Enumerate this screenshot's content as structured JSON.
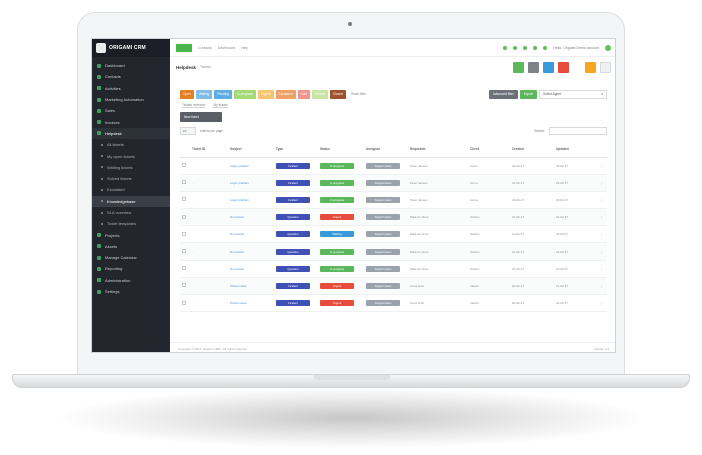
{
  "app": {
    "logo_text": "ORIGAMI CRM"
  },
  "sidebar": {
    "items": [
      {
        "label": "Dashboard",
        "kind": "top"
      },
      {
        "label": "Contacts",
        "kind": "top"
      },
      {
        "label": "Activities",
        "kind": "top"
      },
      {
        "label": "Marketing Automation",
        "kind": "top"
      },
      {
        "label": "Sales",
        "kind": "top"
      },
      {
        "label": "Invoices",
        "kind": "top"
      },
      {
        "label": "Helpdesk",
        "kind": "parent"
      },
      {
        "label": "All tickets",
        "kind": "sub"
      },
      {
        "label": "My open tickets",
        "kind": "sub"
      },
      {
        "label": "Waiting tickets",
        "kind": "sub"
      },
      {
        "label": "Solved tickets",
        "kind": "sub"
      },
      {
        "label": "Escalated",
        "kind": "sub"
      },
      {
        "label": "Knowledgebase",
        "kind": "sub-active"
      },
      {
        "label": "SLA overview",
        "kind": "sub"
      },
      {
        "label": "Ticket templates",
        "kind": "sub"
      },
      {
        "label": "Projects",
        "kind": "top"
      },
      {
        "label": "Assets",
        "kind": "top"
      },
      {
        "label": "Manage Calendar",
        "kind": "top"
      },
      {
        "label": "Reporting",
        "kind": "top"
      },
      {
        "label": "Administration",
        "kind": "top"
      },
      {
        "label": "Settings",
        "kind": "top"
      }
    ]
  },
  "topbar": {
    "links": [
      "Contacts",
      "Dashboard",
      "Help"
    ],
    "user_text": "Hello, Origami Demo account"
  },
  "titlebar": {
    "title": "Helpdesk",
    "crumb": "Tickets"
  },
  "filters": {
    "chips": [
      {
        "label": "Open",
        "color": "#e67e22"
      },
      {
        "label": "Waiting",
        "color": "#7fbde8"
      },
      {
        "label": "Pending",
        "color": "#5dade2"
      },
      {
        "label": "In progress",
        "color": "#a3d977"
      },
      {
        "label": "Urgent",
        "color": "#f8c471"
      },
      {
        "label": "Escalated",
        "color": "#f0a064"
      },
      {
        "label": "Hold",
        "color": "#f1948a"
      },
      {
        "label": "Solved",
        "color": "#c8e6a0"
      },
      {
        "label": "Closed",
        "color": "#a0522d"
      }
    ],
    "reset": "Reset filter",
    "advanced_button": "Advanced filter",
    "export_button": "Export",
    "select_value": "Select Agent"
  },
  "tabs": [
    "Tickets overview",
    "My tickets"
  ],
  "new_button": "New ticket",
  "table_tools": {
    "show": "10",
    "entries": "entries per page",
    "search_label": "Search:"
  },
  "table": {
    "columns": [
      "",
      "Ticket ID",
      "Subject",
      "Type",
      "Status",
      "Assignee",
      "Requester",
      "Client",
      "Created",
      "Updated",
      ""
    ],
    "rows": [
      {
        "subject": "Login problem",
        "type": "Incident",
        "status": "In progress",
        "status_color": "#5cb85c",
        "assignee": "Support team",
        "requester": "Peter Jansen",
        "client": "Acme",
        "created": "22-02-17",
        "updated": "23-02-17"
      },
      {
        "subject": "Login problem",
        "type": "Incident",
        "status": "In progress",
        "status_color": "#5cb85c",
        "assignee": "Support team",
        "requester": "Peter Jansen",
        "client": "Acme",
        "created": "22-02-17",
        "updated": "23-02-17"
      },
      {
        "subject": "Login problem",
        "type": "Incident",
        "status": "In progress",
        "status_color": "#5cb85c",
        "assignee": "Support team",
        "requester": "Peter Jansen",
        "client": "Acme",
        "created": "22-02-17",
        "updated": "23-02-17"
      },
      {
        "subject": "No invoice",
        "type": "Question",
        "status": "Urgent",
        "status_color": "#e74c3c",
        "assignee": "Support team",
        "requester": "Mark de Vries",
        "client": "Globex",
        "created": "21-02-17",
        "updated": "22-02-17"
      },
      {
        "subject": "No invoice",
        "type": "Question",
        "status": "Waiting",
        "status_color": "#3a9ad9",
        "assignee": "Support team",
        "requester": "Mark de Vries",
        "client": "Globex",
        "created": "21-02-17",
        "updated": "22-02-17"
      },
      {
        "subject": "No invoice",
        "type": "Question",
        "status": "In progress",
        "status_color": "#5cb85c",
        "assignee": "Support team",
        "requester": "Mark de Vries",
        "client": "Globex",
        "created": "21-02-17",
        "updated": "22-02-17"
      },
      {
        "subject": "No invoice",
        "type": "Question",
        "status": "In progress",
        "status_color": "#5cb85c",
        "assignee": "Support team",
        "requester": "Mark de Vries",
        "client": "Globex",
        "created": "21-02-17",
        "updated": "22-02-17"
      },
      {
        "subject": "Printer issue",
        "type": "Incident",
        "status": "Urgent",
        "status_color": "#e74c3c",
        "assignee": "Support team",
        "requester": "Anna Smit",
        "client": "Initech",
        "created": "20-02-17",
        "updated": "21-02-17"
      },
      {
        "subject": "Printer issue",
        "type": "Incident",
        "status": "Urgent",
        "status_color": "#e74c3c",
        "assignee": "Support team",
        "requester": "Anna Smit",
        "client": "Initech",
        "created": "20-02-17",
        "updated": "21-02-17"
      }
    ]
  },
  "footer": {
    "left": "Copyright © 2017 Origami CRM - All rights reserved",
    "right": "Version 2.4"
  },
  "colors": {
    "type_pill": "#3f51b5",
    "assignee_pill": "#9aa3ad",
    "accent": "#49b649"
  }
}
